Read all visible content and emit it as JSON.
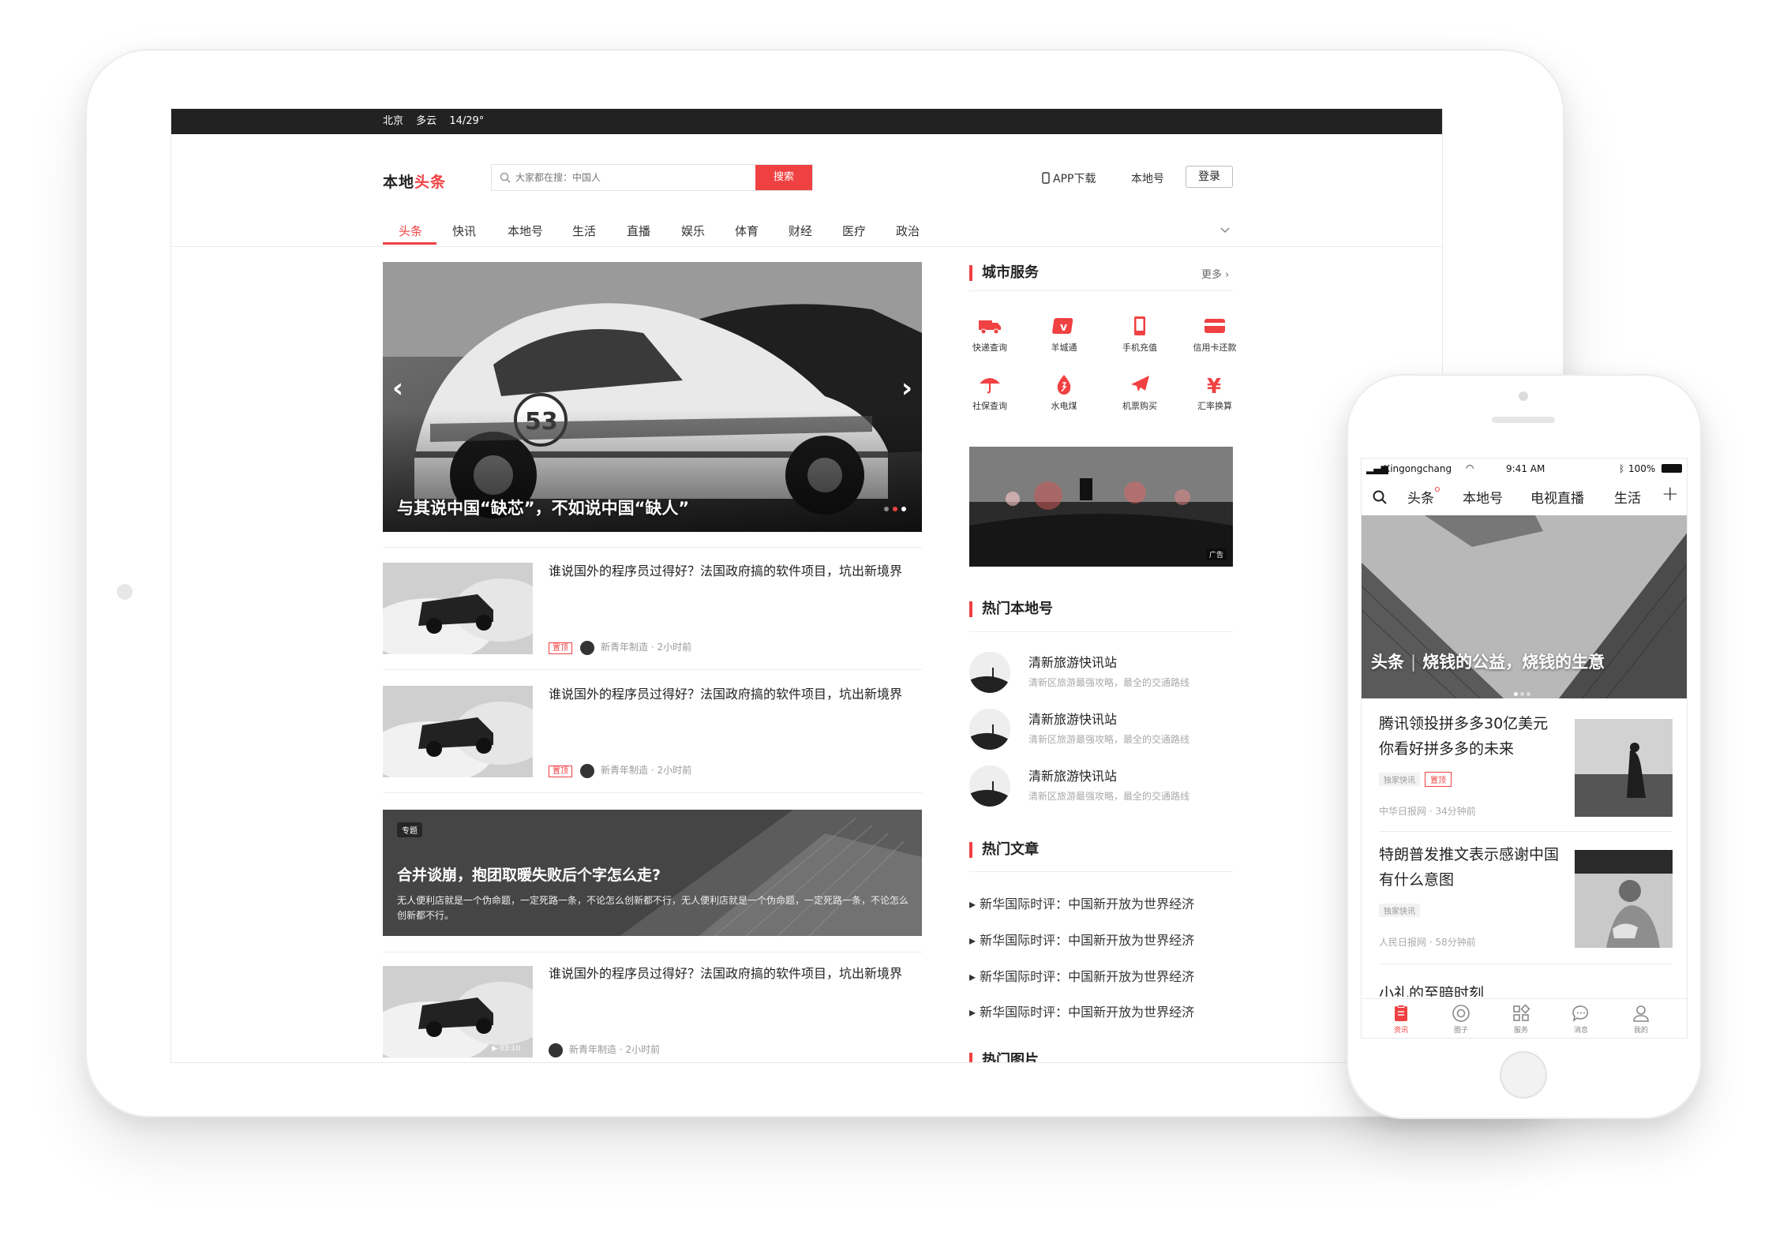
{
  "tablet": {
    "topbar": {
      "city": "北京",
      "weather": "多云",
      "temp": "14/29°"
    },
    "logo": {
      "part1": "本地",
      "part2": "头条"
    },
    "search": {
      "placeholder": "大家都在搜：中国人",
      "button": "搜索"
    },
    "header_links": {
      "app_download": "APP下载",
      "local_account": "本地号",
      "login": "登录"
    },
    "tabs": [
      "头条",
      "快讯",
      "本地号",
      "生活",
      "直播",
      "娱乐",
      "体育",
      "财经",
      "医疗",
      "政治"
    ],
    "hero": {
      "caption": "与其说中国“缺芯”，不如说中国“缺人”"
    },
    "articles": [
      {
        "title": "谁说国外的程序员过得好？法国政府搞的软件项目，坑出新境界",
        "badge": "置顶",
        "source": "新青年制造",
        "time": "2小时前"
      },
      {
        "title": "谁说国外的程序员过得好？法国政府搞的软件项目，坑出新境界",
        "badge": "置顶",
        "source": "新青年制造",
        "time": "2小时前"
      },
      {
        "title": "谁说国外的程序员过得好？法国政府搞的软件项目，坑出新境界",
        "badge": "",
        "source": "新青年制造",
        "time": "2小时前",
        "duration": "03:10"
      }
    ],
    "topic": {
      "tag": "专题",
      "title": "合并谈崩，抱团取暖失败后个字怎么走?",
      "summary": "无人便利店就是一个伪命题，一定死路一条，不论怎么创新都不行，无人便利店就是一个伪命题，一定死路一条，不论怎么创新都不行。"
    },
    "sidebar": {
      "city_services": {
        "title": "城市服务",
        "more": "更多",
        "items": [
          {
            "label": "快递查询",
            "icon": "truck-icon"
          },
          {
            "label": "羊城通",
            "icon": "card-v-icon"
          },
          {
            "label": "手机充值",
            "icon": "phone-icon"
          },
          {
            "label": "信用卡还款",
            "icon": "credit-card-icon"
          },
          {
            "label": "社保查询",
            "icon": "umbrella-icon"
          },
          {
            "label": "水电煤",
            "icon": "drop-icon"
          },
          {
            "label": "机票购买",
            "icon": "plane-icon"
          },
          {
            "label": "汇率换算",
            "icon": "yen-icon"
          }
        ]
      },
      "ad_label": "广告",
      "hot_accounts": {
        "title": "热门本地号",
        "items": [
          {
            "name": "清新旅游快讯站",
            "desc": "清新区旅游最强攻略，最全的交通路线"
          },
          {
            "name": "清新旅游快讯站",
            "desc": "清新区旅游最强攻略，最全的交通路线"
          },
          {
            "name": "清新旅游快讯站",
            "desc": "清新区旅游最强攻略，最全的交通路线"
          }
        ]
      },
      "hot_articles": {
        "title": "热门文章",
        "items": [
          "新华国际时评：中国新开放为世界经济",
          "新华国际时评：中国新开放为世界经济",
          "新华国际时评：中国新开放为世界经济",
          "新华国际时评：中国新开放为世界经济"
        ]
      },
      "hot_pictures": {
        "title": "热门图片"
      }
    }
  },
  "phone": {
    "status": {
      "carrier": "Xingongchang",
      "time": "9:41 AM",
      "battery": "100%"
    },
    "tabs": [
      "头条",
      "本地号",
      "电视直播",
      "生活"
    ],
    "hero": {
      "tag": "头条",
      "caption": "烧钱的公益，烧钱的生意"
    },
    "news": [
      {
        "title": "腾讯领投拼多多30亿美元你看好拼多多的未来",
        "tags": [
          "独家快讯",
          "置顶"
        ],
        "source": "中华日报网",
        "time": "34分钟前"
      },
      {
        "title": "特朗普发推文表示感谢中国有什么意图",
        "tags": [
          "独家快讯"
        ],
        "source": "人民日报网",
        "time": "58分钟前"
      },
      {
        "title": "小礼的至暗时刻"
      }
    ],
    "nav": [
      {
        "label": "资讯",
        "icon": "news-icon"
      },
      {
        "label": "圈子",
        "icon": "circle-icon"
      },
      {
        "label": "服务",
        "icon": "grid-icon"
      },
      {
        "label": "消息",
        "icon": "chat-icon"
      },
      {
        "label": "我的",
        "icon": "user-icon"
      }
    ]
  },
  "colors": {
    "accent": "#f04142",
    "topbar": "#222222"
  }
}
